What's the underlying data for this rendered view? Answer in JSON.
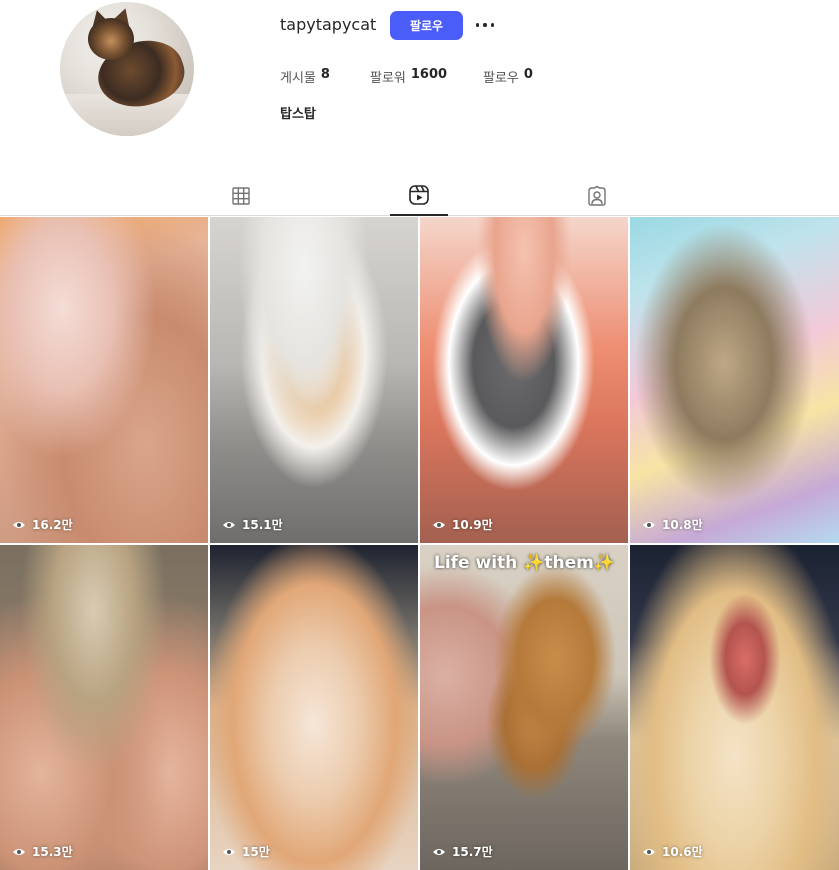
{
  "profile": {
    "username": "tapytapycat",
    "follow_label": "팔로우",
    "more_icon": "more-horizontal-icon",
    "stats": {
      "posts_label": "게시물",
      "posts_value": "8",
      "followers_label": "팔로워",
      "followers_value": "1600",
      "following_label": "팔로우",
      "following_value": "0"
    },
    "display_name": "탑스탑"
  },
  "tabs": [
    {
      "icon": "grid-icon",
      "active": false
    },
    {
      "icon": "reels-icon",
      "active": true
    },
    {
      "icon": "tagged-icon",
      "active": false
    }
  ],
  "accent_color": "#4a5df9",
  "reels": [
    {
      "views": "16.2만"
    },
    {
      "views": "15.1만"
    },
    {
      "views": "10.9만"
    },
    {
      "views": "10.8만"
    },
    {
      "views": "15.3만"
    },
    {
      "views": "15만"
    },
    {
      "views": "15.7만",
      "overlay": "Life with ✨them✨"
    },
    {
      "views": "10.6만"
    }
  ]
}
